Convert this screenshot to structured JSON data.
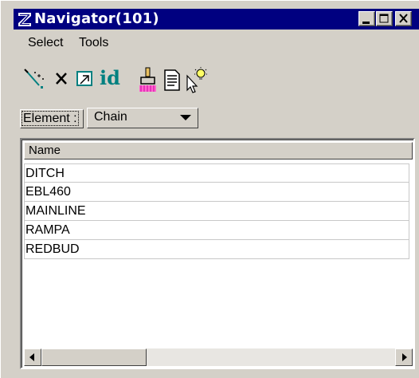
{
  "window": {
    "title": "Navigator(101)",
    "title_bar_color": "#000080"
  },
  "menu": {
    "items": [
      "Select",
      "Tools"
    ]
  },
  "toolbar": {
    "tools": [
      "magic-wand-icon",
      "delete-x-icon",
      "fit-view-icon",
      "id-icon",
      "highlight-paint-icon",
      "report-icon",
      "cursor-bulb-icon"
    ],
    "id_text": "id"
  },
  "filter": {
    "label": "Element :",
    "selected": "Chain"
  },
  "list": {
    "column_header": "Name",
    "rows": [
      "DITCH",
      "EBL460",
      "MAINLINE",
      "RAMPA",
      "REDBUD"
    ]
  }
}
